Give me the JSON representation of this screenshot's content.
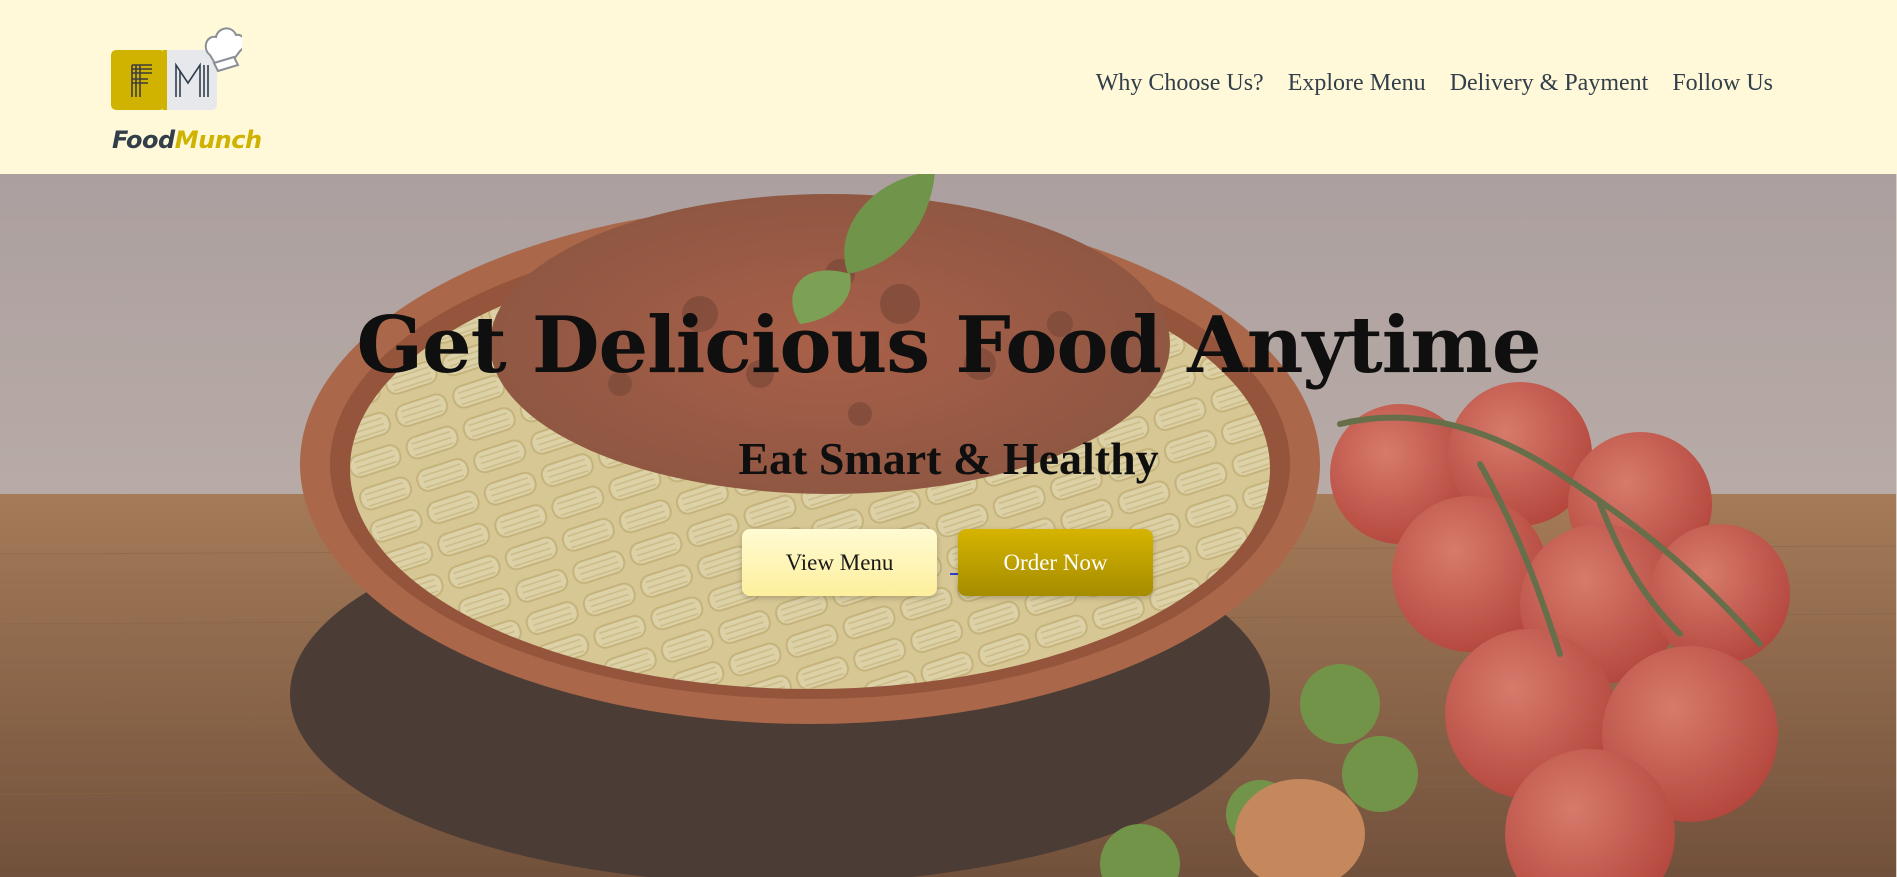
{
  "brand": {
    "monogram_left": "F",
    "monogram_right": "M",
    "name_part1": "Food",
    "name_part2": "Munch",
    "icon": "chef-hat-icon",
    "colors": {
      "accent": "#d0b200",
      "dark": "#323f4b",
      "header_bg": "#fff9d9"
    }
  },
  "nav": {
    "links": [
      {
        "label": "Why Choose Us?"
      },
      {
        "label": "Explore Menu"
      },
      {
        "label": "Delivery & Payment"
      },
      {
        "label": "Follow Us"
      }
    ]
  },
  "hero": {
    "title": "Get Delicious Food Anytime",
    "subtitle": "Eat Smart & Healthy",
    "primary_button": "View Menu",
    "secondary_button": "Order Now",
    "background_image": "pasta-bolognese-bowl-with-tomatoes"
  }
}
